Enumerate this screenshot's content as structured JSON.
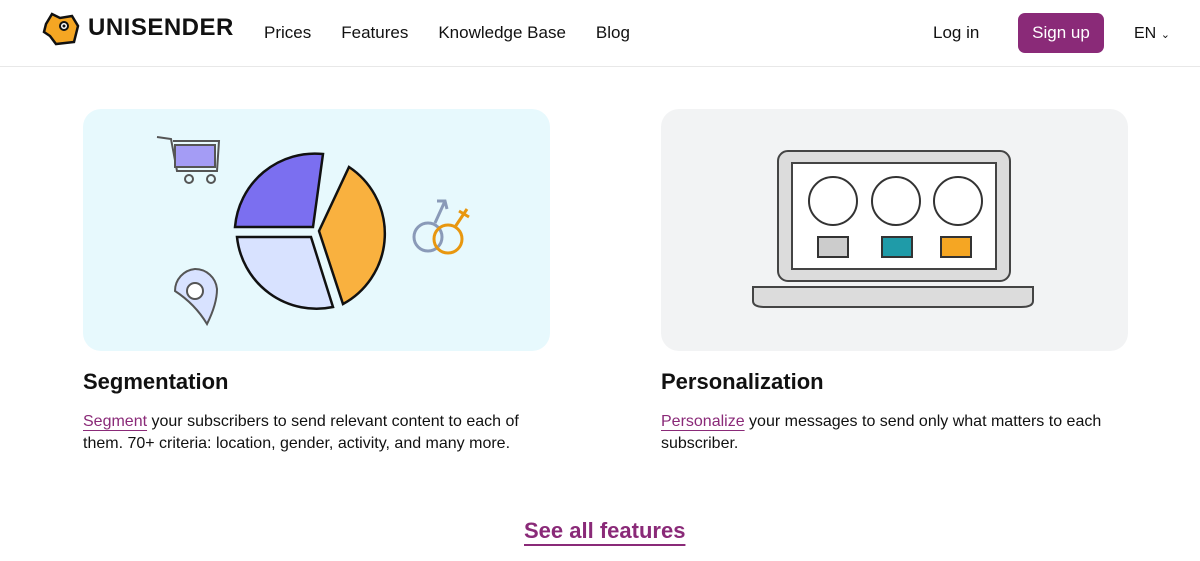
{
  "header": {
    "brand": "UNISENDER",
    "nav": [
      "Prices",
      "Features",
      "Knowledge Base",
      "Blog"
    ],
    "login": "Log in",
    "signup": "Sign up",
    "lang": "EN"
  },
  "features": [
    {
      "title": "Segmentation",
      "link": "Segment",
      "text": " your subscribers to send relevant content to each of them. 70+ criteria: location, gender, activity, and many more."
    },
    {
      "title": "Personalization",
      "link": "Personalize",
      "text": " your messages to send only what matters to each subscriber."
    }
  ],
  "see_all": "See all features",
  "colors": {
    "accent": "#8a2a78"
  }
}
